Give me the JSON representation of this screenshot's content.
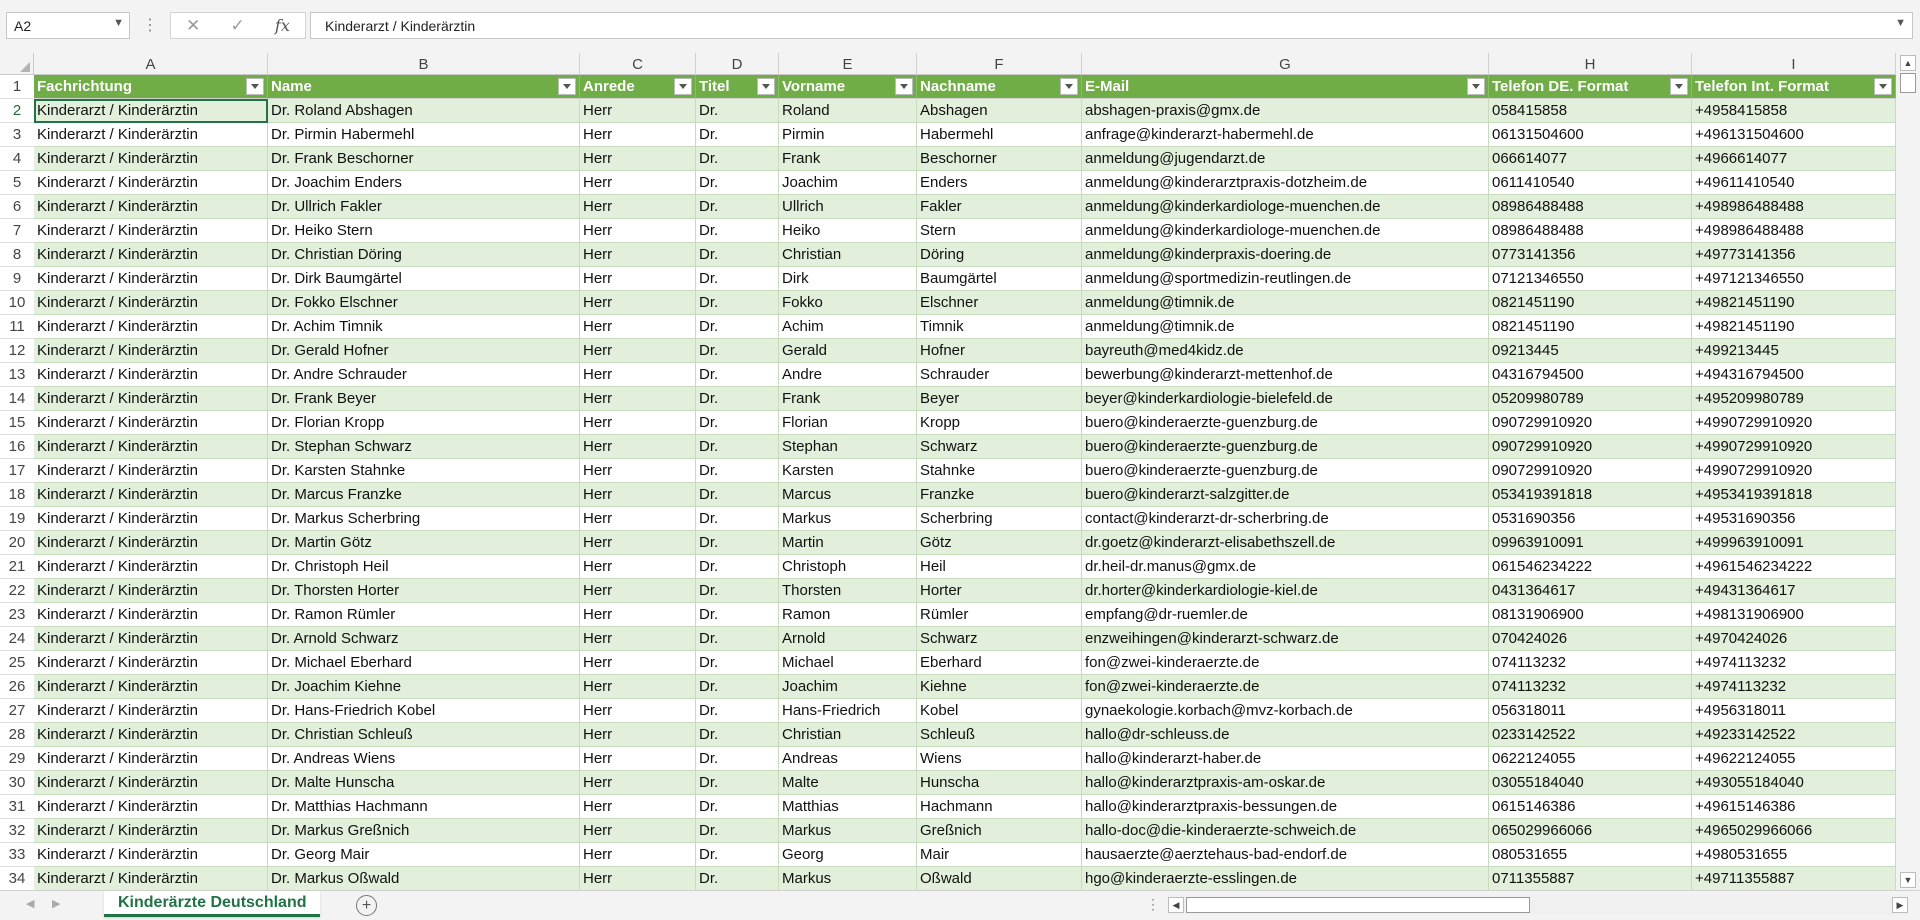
{
  "formula_bar": {
    "name_box": "A2",
    "content": "Kinderarzt / Kinderärztin",
    "fx": "fx",
    "cancel": "✕",
    "enter": "✓"
  },
  "columns": [
    "A",
    "B",
    "C",
    "D",
    "E",
    "F",
    "G",
    "H",
    "I"
  ],
  "headers": [
    "Fachrichtung",
    "Name",
    "Anrede",
    "Titel",
    "Vorname",
    "Nachname",
    "E-Mail",
    "Telefon DE. Format",
    "Telefon Int. Format"
  ],
  "row_numbers": [
    "1",
    "2",
    "3",
    "4",
    "5",
    "6",
    "7",
    "8",
    "9",
    "10",
    "11",
    "12",
    "13",
    "14",
    "15",
    "16",
    "17",
    "18",
    "19",
    "20",
    "21",
    "22",
    "23",
    "24",
    "25",
    "26",
    "27",
    "28",
    "29",
    "30",
    "31",
    "32",
    "33",
    "34"
  ],
  "rows": [
    [
      "Kinderarzt / Kinderärztin",
      "Dr. Roland Abshagen",
      "Herr",
      "Dr.",
      "Roland",
      "Abshagen",
      "abshagen-praxis@gmx.de",
      "058415858",
      "+4958415858"
    ],
    [
      "Kinderarzt / Kinderärztin",
      "Dr. Pirmin Habermehl",
      "Herr",
      "Dr.",
      "Pirmin",
      "Habermehl",
      "anfrage@kinderarzt-habermehl.de",
      "06131504600",
      "+496131504600"
    ],
    [
      "Kinderarzt / Kinderärztin",
      "Dr. Frank Beschorner",
      "Herr",
      "Dr.",
      "Frank",
      "Beschorner",
      "anmeldung@jugendarzt.de",
      "066614077",
      "+4966614077"
    ],
    [
      "Kinderarzt / Kinderärztin",
      "Dr. Joachim Enders",
      "Herr",
      "Dr.",
      "Joachim",
      "Enders",
      "anmeldung@kinderarztpraxis-dotzheim.de",
      "0611410540",
      "+49611410540"
    ],
    [
      "Kinderarzt / Kinderärztin",
      "Dr. Ullrich Fakler",
      "Herr",
      "Dr.",
      "Ullrich",
      "Fakler",
      "anmeldung@kinderkardiologe-muenchen.de",
      "08986488488",
      "+498986488488"
    ],
    [
      "Kinderarzt / Kinderärztin",
      "Dr. Heiko Stern",
      "Herr",
      "Dr.",
      "Heiko",
      "Stern",
      "anmeldung@kinderkardiologe-muenchen.de",
      "08986488488",
      "+498986488488"
    ],
    [
      "Kinderarzt / Kinderärztin",
      "Dr. Christian Döring",
      "Herr",
      "Dr.",
      "Christian",
      "Döring",
      "anmeldung@kinderpraxis-doering.de",
      "0773141356",
      "+49773141356"
    ],
    [
      "Kinderarzt / Kinderärztin",
      "Dr. Dirk Baumgärtel",
      "Herr",
      "Dr.",
      "Dirk",
      "Baumgärtel",
      "anmeldung@sportmedizin-reutlingen.de",
      "07121346550",
      "+497121346550"
    ],
    [
      "Kinderarzt / Kinderärztin",
      "Dr. Fokko Elschner",
      "Herr",
      "Dr.",
      "Fokko",
      "Elschner",
      "anmeldung@timnik.de",
      "0821451190",
      "+49821451190"
    ],
    [
      "Kinderarzt / Kinderärztin",
      "Dr. Achim Timnik",
      "Herr",
      "Dr.",
      "Achim",
      "Timnik",
      "anmeldung@timnik.de",
      "0821451190",
      "+49821451190"
    ],
    [
      "Kinderarzt / Kinderärztin",
      "Dr. Gerald Hofner",
      "Herr",
      "Dr.",
      "Gerald",
      "Hofner",
      "bayreuth@med4kidz.de",
      "09213445",
      "+499213445"
    ],
    [
      "Kinderarzt / Kinderärztin",
      "Dr. Andre Schrauder",
      "Herr",
      "Dr.",
      "Andre",
      "Schrauder",
      "bewerbung@kinderarzt-mettenhof.de",
      "04316794500",
      "+494316794500"
    ],
    [
      "Kinderarzt / Kinderärztin",
      "Dr. Frank Beyer",
      "Herr",
      "Dr.",
      "Frank",
      "Beyer",
      "beyer@kinderkardiologie-bielefeld.de",
      "05209980789",
      "+495209980789"
    ],
    [
      "Kinderarzt / Kinderärztin",
      "Dr. Florian Kropp",
      "Herr",
      "Dr.",
      "Florian",
      "Kropp",
      "buero@kinderaerzte-guenzburg.de",
      "090729910920",
      "+4990729910920"
    ],
    [
      "Kinderarzt / Kinderärztin",
      "Dr. Stephan Schwarz",
      "Herr",
      "Dr.",
      "Stephan",
      "Schwarz",
      "buero@kinderaerzte-guenzburg.de",
      "090729910920",
      "+4990729910920"
    ],
    [
      "Kinderarzt / Kinderärztin",
      "Dr. Karsten Stahnke",
      "Herr",
      "Dr.",
      "Karsten",
      "Stahnke",
      "buero@kinderaerzte-guenzburg.de",
      "090729910920",
      "+4990729910920"
    ],
    [
      "Kinderarzt / Kinderärztin",
      "Dr. Marcus Franzke",
      "Herr",
      "Dr.",
      "Marcus",
      "Franzke",
      "buero@kinderarzt-salzgitter.de",
      "053419391818",
      "+4953419391818"
    ],
    [
      "Kinderarzt / Kinderärztin",
      "Dr. Markus Scherbring",
      "Herr",
      "Dr.",
      "Markus",
      "Scherbring",
      "contact@kinderarzt-dr-scherbring.de",
      "0531690356",
      "+49531690356"
    ],
    [
      "Kinderarzt / Kinderärztin",
      "Dr. Martin Götz",
      "Herr",
      "Dr.",
      "Martin",
      "Götz",
      "dr.goetz@kinderarzt-elisabethszell.de",
      "09963910091",
      "+499963910091"
    ],
    [
      "Kinderarzt / Kinderärztin",
      "Dr. Christoph Heil",
      "Herr",
      "Dr.",
      "Christoph",
      "Heil",
      "dr.heil-dr.manus@gmx.de",
      "061546234222",
      "+4961546234222"
    ],
    [
      "Kinderarzt / Kinderärztin",
      "Dr. Thorsten Horter",
      "Herr",
      "Dr.",
      "Thorsten",
      "Horter",
      "dr.horter@kinderkardiologie-kiel.de",
      "0431364617",
      "+49431364617"
    ],
    [
      "Kinderarzt / Kinderärztin",
      "Dr. Ramon Rümler",
      "Herr",
      "Dr.",
      "Ramon",
      "Rümler",
      "empfang@dr-ruemler.de",
      "08131906900",
      "+498131906900"
    ],
    [
      "Kinderarzt / Kinderärztin",
      "Dr. Arnold Schwarz",
      "Herr",
      "Dr.",
      "Arnold",
      "Schwarz",
      "enzweihingen@kinderarzt-schwarz.de",
      "070424026",
      "+4970424026"
    ],
    [
      "Kinderarzt / Kinderärztin",
      "Dr. Michael Eberhard",
      "Herr",
      "Dr.",
      "Michael",
      "Eberhard",
      "fon@zwei-kinderaerzte.de",
      "074113232",
      "+4974113232"
    ],
    [
      "Kinderarzt / Kinderärztin",
      "Dr. Joachim Kiehne",
      "Herr",
      "Dr.",
      "Joachim",
      "Kiehne",
      "fon@zwei-kinderaerzte.de",
      "074113232",
      "+4974113232"
    ],
    [
      "Kinderarzt / Kinderärztin",
      "Dr. Hans-Friedrich Kobel",
      "Herr",
      "Dr.",
      "Hans-Friedrich",
      "Kobel",
      "gynaekologie.korbach@mvz-korbach.de",
      "056318011",
      "+4956318011"
    ],
    [
      "Kinderarzt / Kinderärztin",
      "Dr. Christian Schleuß",
      "Herr",
      "Dr.",
      "Christian",
      "Schleuß",
      "hallo@dr-schleuss.de",
      "0233142522",
      "+49233142522"
    ],
    [
      "Kinderarzt / Kinderärztin",
      "Dr. Andreas Wiens",
      "Herr",
      "Dr.",
      "Andreas",
      "Wiens",
      "hallo@kinderarzt-haber.de",
      "0622124055",
      "+49622124055"
    ],
    [
      "Kinderarzt / Kinderärztin",
      "Dr. Malte Hunscha",
      "Herr",
      "Dr.",
      "Malte",
      "Hunscha",
      "hallo@kinderarztpraxis-am-oskar.de",
      "03055184040",
      "+493055184040"
    ],
    [
      "Kinderarzt / Kinderärztin",
      "Dr. Matthias Hachmann",
      "Herr",
      "Dr.",
      "Matthias",
      "Hachmann",
      "hallo@kinderarztpraxis-bessungen.de",
      "0615146386",
      "+49615146386"
    ],
    [
      "Kinderarzt / Kinderärztin",
      "Dr. Markus Greßnich",
      "Herr",
      "Dr.",
      "Markus",
      "Greßnich",
      "hallo-doc@die-kinderaerzte-schweich.de",
      "065029966066",
      "+4965029966066"
    ],
    [
      "Kinderarzt / Kinderärztin",
      "Dr. Georg Mair",
      "Herr",
      "Dr.",
      "Georg",
      "Mair",
      "hausaerzte@aerztehaus-bad-endorf.de",
      "080531655",
      "+4980531655"
    ],
    [
      "Kinderarzt / Kinderärztin",
      "Dr. Markus Oßwald",
      "Herr",
      "Dr.",
      "Markus",
      "Oßwald",
      "hgo@kinderaerzte-esslingen.de",
      "0711355887",
      "+49711355887"
    ]
  ],
  "sheet_tab": "Kinderärzte Deutschland",
  "add_sheet": "+",
  "colors": {
    "header_green": "#70ad47",
    "band_green": "#e2efda",
    "accent": "#217346"
  }
}
